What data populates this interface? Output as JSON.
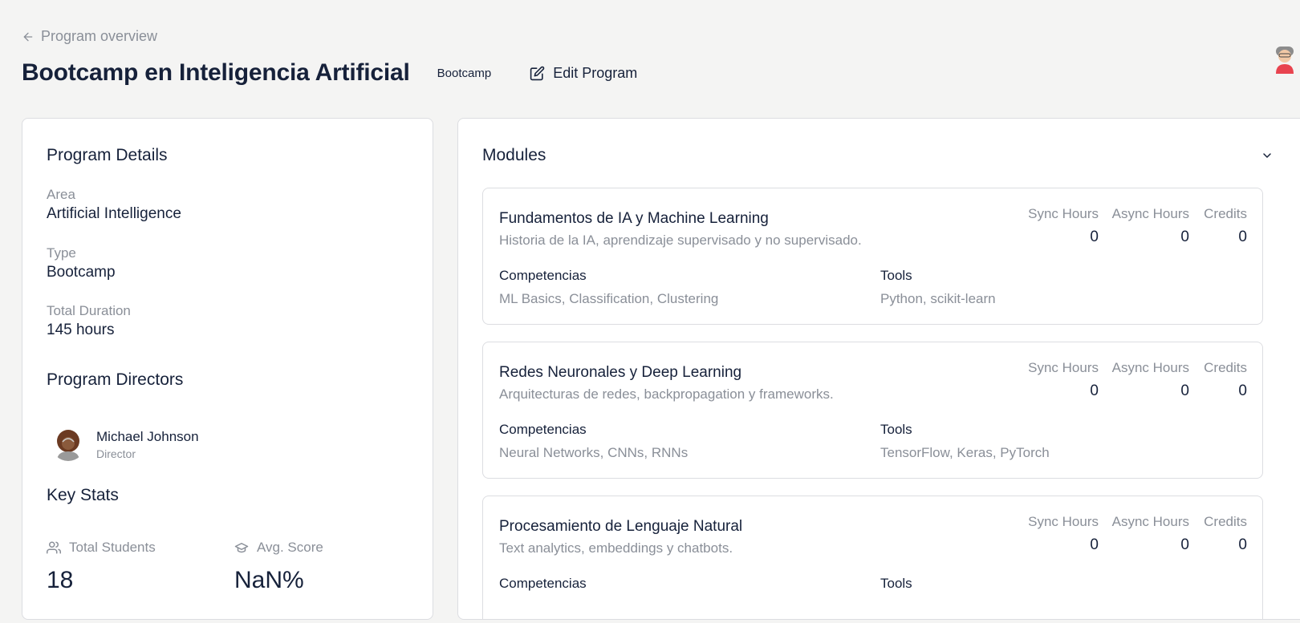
{
  "nav": {
    "back_label": "Program overview"
  },
  "header": {
    "title": "Bootcamp en Inteligencia Artificial",
    "type_badge": "Bootcamp",
    "edit_label": "Edit Program"
  },
  "details": {
    "title": "Program Details",
    "area_label": "Area",
    "area_value": "Artificial Intelligence",
    "type_label": "Type",
    "type_value": "Bootcamp",
    "duration_label": "Total Duration",
    "duration_value": "145 hours"
  },
  "directors": {
    "title": "Program Directors",
    "items": [
      {
        "name": "Michael Johnson",
        "role": "Director"
      }
    ]
  },
  "stats": {
    "title": "Key Stats",
    "students_label": "Total Students",
    "students_value": "18",
    "score_label": "Avg. Score",
    "score_value": "NaN%"
  },
  "modules": {
    "title": "Modules",
    "labels": {
      "sync": "Sync Hours",
      "async": "Async Hours",
      "credits": "Credits",
      "competencies": "Competencias",
      "tools": "Tools"
    },
    "items": [
      {
        "name": "Fundamentos de IA y Machine Learning",
        "description": "Historia de la IA, aprendizaje supervisado y no supervisado.",
        "sync": "0",
        "async": "0",
        "credits": "0",
        "competencies": "ML Basics, Classification, Clustering",
        "tools": "Python, scikit-learn"
      },
      {
        "name": "Redes Neuronales y Deep Learning",
        "description": "Arquitecturas de redes, backpropagation y frameworks.",
        "sync": "0",
        "async": "0",
        "credits": "0",
        "competencies": "Neural Networks, CNNs, RNNs",
        "tools": "TensorFlow, Keras, PyTorch"
      },
      {
        "name": "Procesamiento de Lenguaje Natural",
        "description": "Text analytics, embeddings y chatbots.",
        "sync": "0",
        "async": "0",
        "credits": "0",
        "competencies": "",
        "tools": ""
      }
    ]
  },
  "icons": {
    "back": "arrow-left-icon",
    "edit": "edit-icon",
    "collapse": "chevron-down-icon",
    "students": "users-icon",
    "score": "graduation-cap-icon"
  },
  "colors": {
    "background": "#f4f4f3",
    "text_primary": "#16213a",
    "text_muted": "#8a8f98",
    "border": "#dcdde1"
  }
}
